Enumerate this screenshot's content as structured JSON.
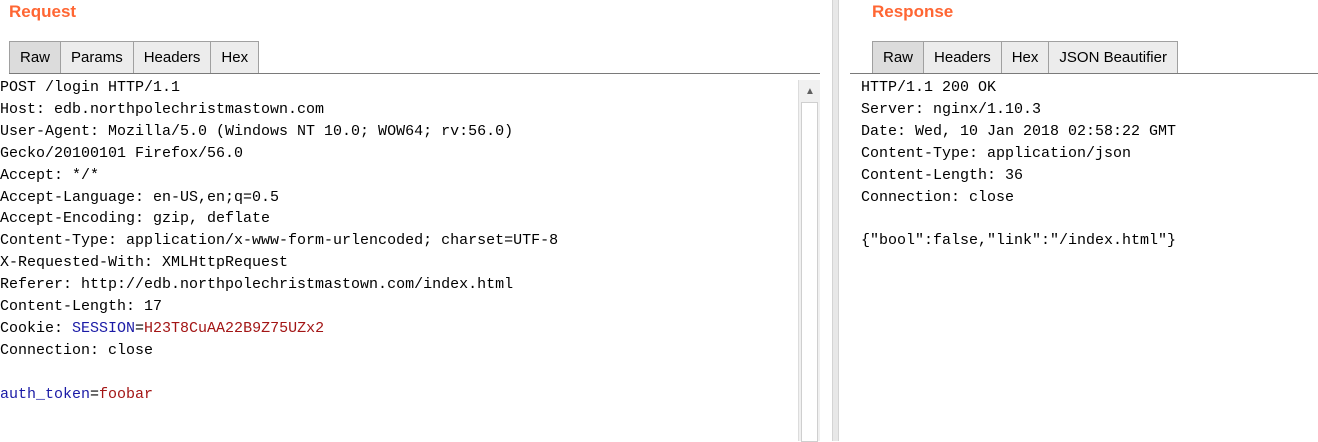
{
  "request": {
    "title": "Request",
    "tabs": [
      "Raw",
      "Params",
      "Headers",
      "Hex"
    ],
    "active_tab": "Raw",
    "lines": [
      "POST /login HTTP/1.1",
      "Host: edb.northpolechristmastown.com",
      "User-Agent: Mozilla/5.0 (Windows NT 10.0; WOW64; rv:56.0)",
      "Gecko/20100101 Firefox/56.0",
      "Accept: */*",
      "Accept-Language: en-US,en;q=0.5",
      "Accept-Encoding: gzip, deflate",
      "Content-Type: application/x-www-form-urlencoded; charset=UTF-8",
      "X-Requested-With: XMLHttpRequest",
      "Referer: http://edb.northpolechristmastown.com/index.html",
      "Content-Length: 17"
    ],
    "cookie": {
      "prefix": "Cookie: ",
      "name": "SESSION",
      "eq": "=",
      "value": "H23T8CuAA22B9Z75UZx2"
    },
    "connection": "Connection: close",
    "body": {
      "name": "auth_token",
      "eq": "=",
      "value": "foobar"
    }
  },
  "response": {
    "title": "Response",
    "tabs": [
      "Raw",
      "Headers",
      "Hex",
      "JSON Beautifier"
    ],
    "active_tab": "Raw",
    "lines": [
      "HTTP/1.1 200 OK",
      "Server: nginx/1.10.3",
      "Date: Wed, 10 Jan 2018 02:58:22 GMT",
      "Content-Type: application/json",
      "Content-Length: 36",
      "Connection: close",
      "",
      "{\"bool\":false,\"link\":\"/index.html\"}"
    ]
  },
  "icons": {
    "scroll_up": "scroll-up-arrow-icon"
  },
  "colors": {
    "title": "#ff6633",
    "param_name": "#1a1aa6",
    "param_value": "#a31515"
  }
}
